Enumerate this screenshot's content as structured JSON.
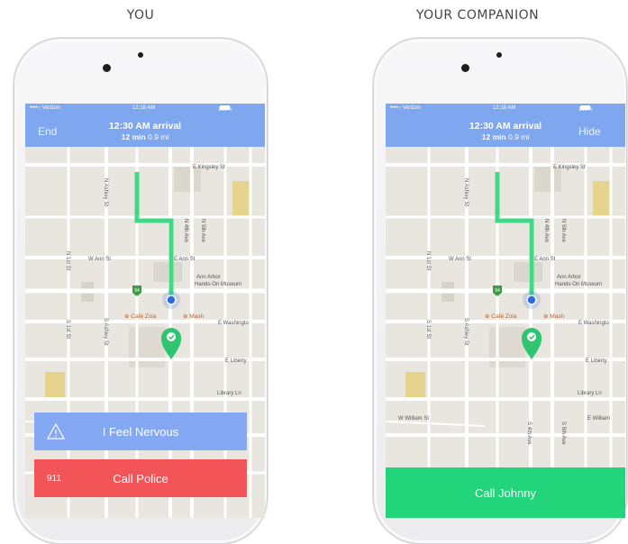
{
  "labels": {
    "left": "YOU",
    "right": "YOUR COMPANION"
  },
  "status": {
    "carrier": "••••○ Verizon",
    "time": "12:18 AM",
    "battery": "100%"
  },
  "nav": {
    "arrival": "12:30 AM arrival",
    "duration": "12 min",
    "distance": "0.9 mi",
    "left_action": "End",
    "right_action": "Hide"
  },
  "map": {
    "streets": {
      "kingsley": "E Kingsley St",
      "ashley_n": "N Ashley St",
      "fifth_n": "N 5th Ave",
      "fourth_n": "N 4th Ave",
      "first_n": "N 1st St",
      "ann_w": "W Ann St",
      "ann_e": "E Ann St",
      "first_s": "S 1st St",
      "ashley_s": "S Ashley St",
      "washington": "E Washingto",
      "liberty": "E Liberty",
      "library": "Library Ln",
      "william_w": "W William St",
      "william_e": "E William",
      "fourth_s": "S 4th Ave",
      "fifth_s": "S 5th Ave"
    },
    "pois": {
      "cafe": "Café Zola",
      "mash": "Mash",
      "museum_1": "Ann Arbor",
      "museum_2": "Hands-On Museum"
    },
    "shield": "94"
  },
  "user_actions": {
    "nervous": "I Feel Nervous",
    "police_icon": "911",
    "police": "Call Police"
  },
  "companion_actions": {
    "call": "Call Johnny"
  },
  "colors": {
    "nav": "#7fa7f0",
    "route": "#3ddc84",
    "police": "#f25458",
    "nervous": "#84a8f3",
    "call": "#22d47a",
    "location": "#2f6ae6"
  }
}
